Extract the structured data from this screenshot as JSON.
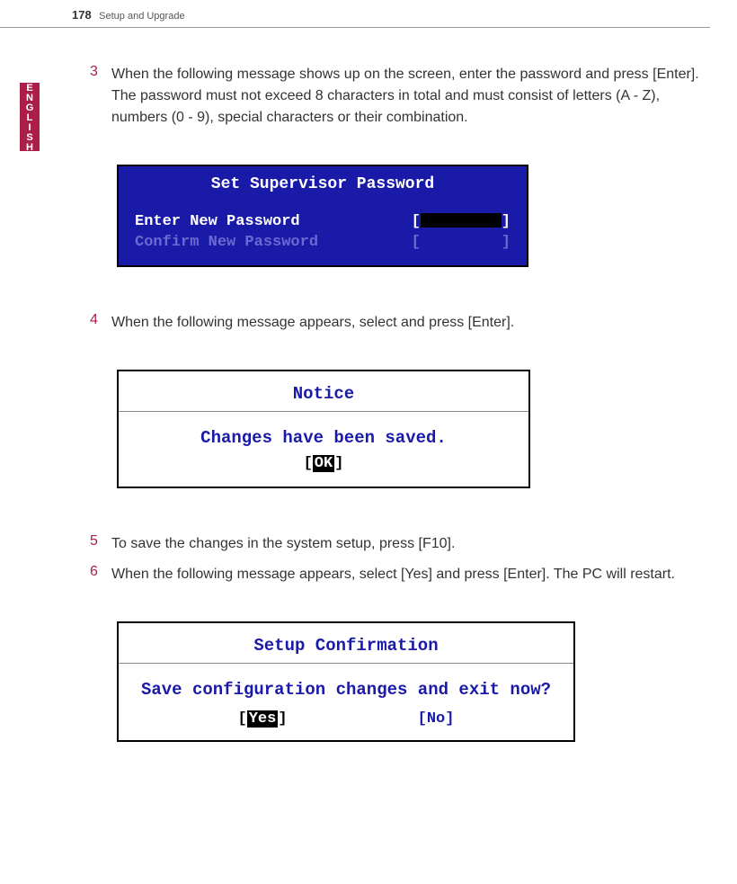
{
  "header": {
    "page_number": "178",
    "section": "Setup and Upgrade"
  },
  "lang_tab": "ENGLISH",
  "steps": {
    "s3": {
      "num": "3",
      "text": "When the following message shows up on the screen, enter the password and press [Enter]. The password must not exceed 8 characters in total and must consist of letters (A - Z), numbers (0 - 9), special characters or their combination."
    },
    "s4": {
      "num": "4",
      "text": "When the following message appears, select and press [Enter]."
    },
    "s5": {
      "num": "5",
      "text": "To save the changes in the system setup, press [F10]."
    },
    "s6": {
      "num": "6",
      "text": "When the following message appears, select [Yes] and press [Enter]. The PC will restart."
    }
  },
  "bios1": {
    "title": "Set Supervisor Password",
    "row1_label": "Enter New Password",
    "row2_label": "Confirm New Password",
    "lbracket": "[",
    "rbracket": "]"
  },
  "dialog2": {
    "title": "Notice",
    "message": "Changes have been saved.",
    "btn_l": "[",
    "btn_sel": "OK",
    "btn_r": "]"
  },
  "dialog3": {
    "title": "Setup Confirmation",
    "message": "Save configuration changes and exit now?",
    "yes_l": "[",
    "yes_sel": "Yes",
    "yes_r": "]",
    "no": "[No]"
  }
}
